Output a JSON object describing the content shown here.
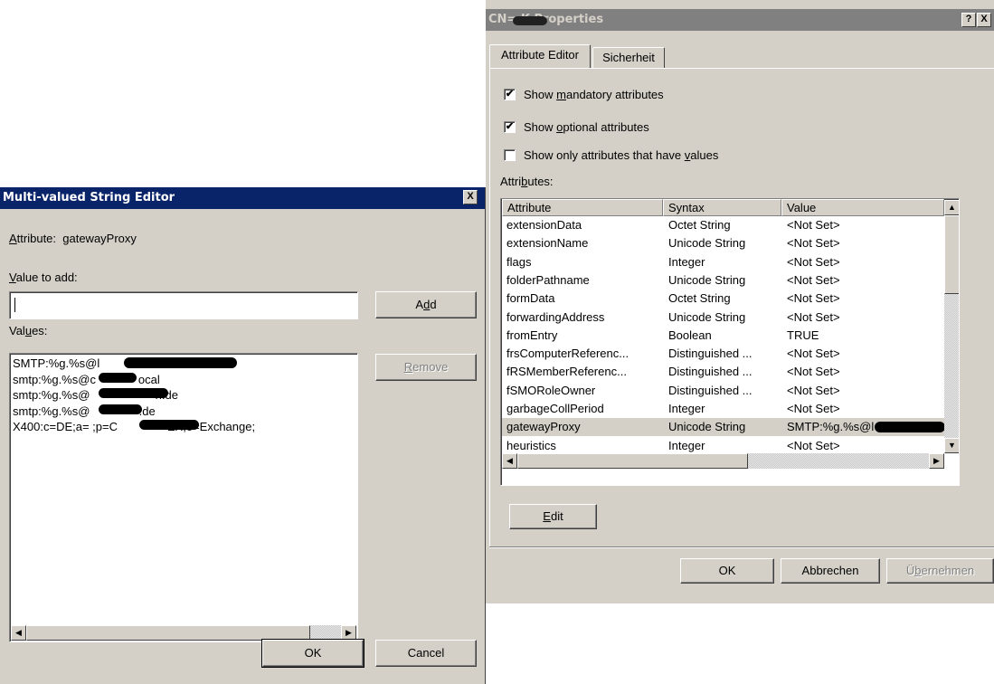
{
  "properties_dialog": {
    "title": "CN=         K Properties",
    "tabs": [
      "Attribute Editor",
      "Sicherheit"
    ],
    "checkboxes": [
      {
        "label": "Show mandatory attributes",
        "checked": true
      },
      {
        "label": "Show optional attributes",
        "checked": true
      },
      {
        "label": "Show only attributes that have values",
        "checked": false
      }
    ],
    "attributes_label": "Attributes:",
    "columns": [
      "Attribute",
      "Syntax",
      "Value"
    ],
    "rows": [
      {
        "attribute": "extensionData",
        "syntax": "Octet String",
        "value": "<Not Set>"
      },
      {
        "attribute": "extensionName",
        "syntax": "Unicode String",
        "value": "<Not Set>"
      },
      {
        "attribute": "flags",
        "syntax": "Integer",
        "value": "<Not Set>"
      },
      {
        "attribute": "folderPathname",
        "syntax": "Unicode String",
        "value": "<Not Set>"
      },
      {
        "attribute": "formData",
        "syntax": "Octet String",
        "value": "<Not Set>"
      },
      {
        "attribute": "forwardingAddress",
        "syntax": "Unicode String",
        "value": "<Not Set>"
      },
      {
        "attribute": "fromEntry",
        "syntax": "Boolean",
        "value": "TRUE"
      },
      {
        "attribute": "frsComputerReferenc...",
        "syntax": "Distinguished ...",
        "value": "<Not Set>"
      },
      {
        "attribute": "fRSMemberReferenc...",
        "syntax": "Distinguished ...",
        "value": "<Not Set>"
      },
      {
        "attribute": "fSMORoleOwner",
        "syntax": "Distinguished ...",
        "value": "<Not Set>"
      },
      {
        "attribute": "garbageCollPeriod",
        "syntax": "Integer",
        "value": "<Not Set>"
      },
      {
        "attribute": "gatewayProxy",
        "syntax": "Unicode String",
        "value": "SMTP:%g.%s@l"
      },
      {
        "attribute": "heuristics",
        "syntax": "Integer",
        "value": "<Not Set>"
      }
    ],
    "selected_row": "gatewayProxy",
    "edit_button": "Edit",
    "ok_button": "OK",
    "cancel_button": "Abbrechen",
    "apply_button": "Übernehmen",
    "help_button": "?",
    "close_button": "X"
  },
  "mv_editor": {
    "title": "Multi-valued String Editor",
    "attribute_line": "Attribute:  gatewayProxy",
    "value_to_add_label": "Value to add:",
    "value_to_add": "",
    "add_button": "Add",
    "values_label": "Values:",
    "values": [
      "SMTP:%g.%s@l                          .de",
      "smtp:%g.%s@c             ocal",
      "smtp:%g.%s@                    h.de",
      "smtp:%g.%s@               .de",
      "X400:c=DE;a= ;p=C              -EX;o=Exchange;"
    ],
    "remove_button": "Remove",
    "ok_button": "OK",
    "cancel_button": "Cancel",
    "close_button": "X"
  },
  "colors": {
    "active_title": "#0a246a",
    "inactive_title": "#808080",
    "face": "#d4d0c8"
  }
}
